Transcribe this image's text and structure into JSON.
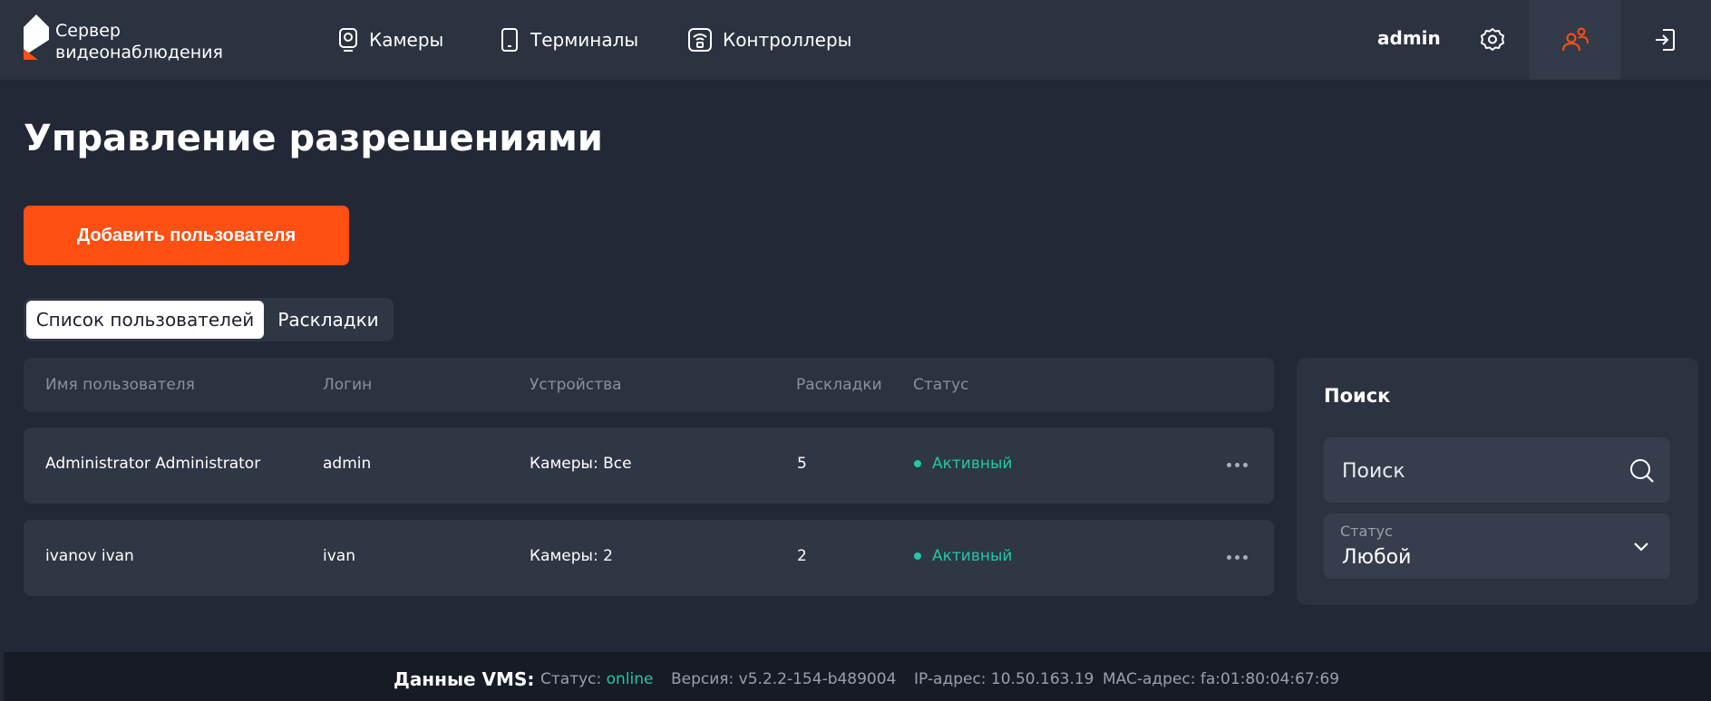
{
  "app": {
    "title_line1": "Сервер",
    "title_line2": "видеонаблюдения",
    "accent": "#ff4f12"
  },
  "nav": {
    "items": [
      {
        "label": "Камеры",
        "icon": "camera-icon"
      },
      {
        "label": "Терминалы",
        "icon": "tablet-icon"
      },
      {
        "label": "Контроллеры",
        "icon": "controller-icon"
      }
    ]
  },
  "user": {
    "name": "admin"
  },
  "page": {
    "title": "Управление разрешениями",
    "add_button": "Добавить пользователя",
    "tabs": [
      {
        "label": "Список пользователей",
        "active": true
      },
      {
        "label": "Раскладки",
        "active": false
      }
    ]
  },
  "table": {
    "columns": [
      "Имя пользователя",
      "Логин",
      "Устройства",
      "Раскладки",
      "Статус"
    ],
    "rows": [
      {
        "name": "Administrator Administrator",
        "login": "admin",
        "devices": "Камеры: Все",
        "layouts": "5",
        "status": "Активный"
      },
      {
        "name": "ivanov ivan",
        "login": "ivan",
        "devices": "Камеры: 2",
        "layouts": "2",
        "status": "Активный"
      }
    ],
    "status_color": "#22c7a5"
  },
  "search": {
    "title": "Поиск",
    "placeholder": "Поиск",
    "status_label": "Статус",
    "status_value": "Любой"
  },
  "footer": {
    "label": "Данные VMS:",
    "status_label": "Статус:",
    "status_value": "online",
    "version": "Версия: v5.2.2-154-b489004",
    "ip": "IP-адрес: 10.50.163.19",
    "mac": "MAC-адрес: fa:01:80:04:67:69"
  }
}
